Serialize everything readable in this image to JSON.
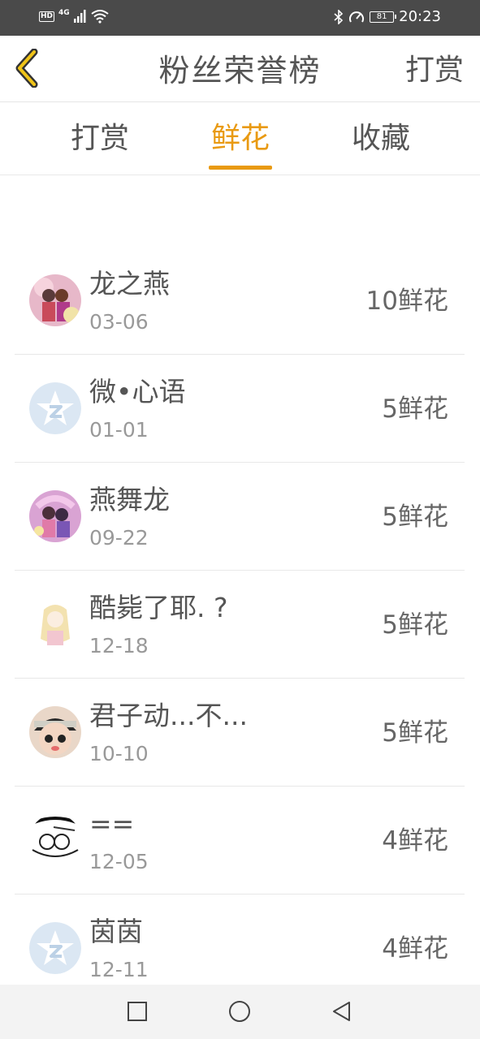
{
  "status_bar": {
    "left_badge": "HD",
    "network": "4G",
    "battery": "81",
    "time": "20:23"
  },
  "header": {
    "title": "粉丝荣誉榜",
    "right_action": "打赏",
    "back_icon": "chevron-left-icon"
  },
  "tabs": [
    {
      "label": "打赏",
      "active": false
    },
    {
      "label": "鲜花",
      "active": true
    },
    {
      "label": "收藏",
      "active": false
    }
  ],
  "accent_color": "#e99a12",
  "fans": [
    {
      "name": "龙之燕",
      "date": "03-06",
      "count": "10鲜花",
      "avatar": "anime-couple-avatar"
    },
    {
      "name": "微•心语",
      "date": "01-01",
      "count": "5鲜花",
      "avatar": "default-qq-avatar"
    },
    {
      "name": "燕舞龙",
      "date": "09-22",
      "count": "5鲜花",
      "avatar": "anime-couple-avatar"
    },
    {
      "name": "酷毙了耶. ?",
      "date": "12-18",
      "count": "5鲜花",
      "avatar": "anime-girl-avatar"
    },
    {
      "name": "君子动...不...",
      "date": "10-10",
      "count": "5鲜花",
      "avatar": "doll-avatar"
    },
    {
      "name": "==",
      "date": "12-05",
      "count": "4鲜花",
      "avatar": "sketch-avatar"
    },
    {
      "name": "茵茵",
      "date": "12-11",
      "count": "4鲜花",
      "avatar": "default-qq-avatar"
    }
  ],
  "nav_bar": {
    "items": [
      "recents-square-icon",
      "home-circle-icon",
      "back-triangle-icon"
    ]
  }
}
